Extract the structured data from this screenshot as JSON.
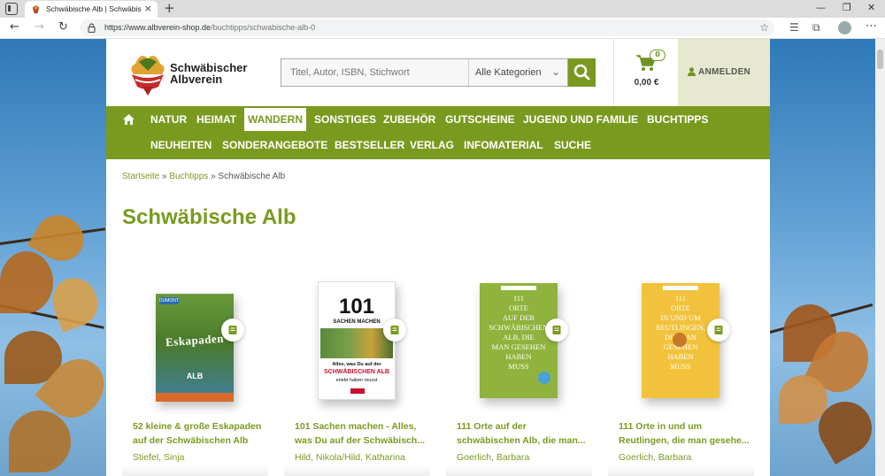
{
  "browser": {
    "tab_title": "Schwäbische Alb | Schwäbischer A",
    "url_host": "https://www.albverein-shop.de",
    "url_path": "/buchtipps/schwabische-alb-0"
  },
  "header": {
    "logo_line1": "Schwäbischer",
    "logo_line2": "Albverein",
    "search_placeholder": "Titel, Autor, ISBN, Stichwort",
    "category_selected": "Alle Kategorien",
    "cart_count": "0",
    "cart_total": "0,00 €",
    "login_label": "ANMELDEN"
  },
  "nav": {
    "row1": [
      "NATUR",
      "HEIMAT",
      "WANDERN",
      "SONSTIGES",
      "ZUBEHÖR",
      "GUTSCHEINE",
      "JUGEND UND FAMILIE",
      "BUCHTIPPS"
    ],
    "row2": [
      "NEUHEITEN",
      "SONDERANGEBOTE",
      "BESTSELLER",
      "VERLAG",
      "INFOMATERIAL",
      "SUCHE"
    ],
    "active": "WANDERN"
  },
  "breadcrumb": {
    "home": "Startseite",
    "sep": "»",
    "parent": "Buchtipps",
    "current": "Schwäbische Alb"
  },
  "page": {
    "title": "Schwäbische Alb"
  },
  "products": [
    {
      "title_line1": "52 kleine & große Eskapaden",
      "title_line2": "auf der Schwäbischen Alb",
      "author": "Stiefel, Sinja",
      "cover_brand": "DUMONT",
      "cover_main": "Eskapaden",
      "cover_sub": "ALB"
    },
    {
      "title_line1": "101 Sachen machen - Alles,",
      "title_line2": "was Du auf der Schwäbisch...",
      "author": "Hild, Nikola/Hild, Katharina",
      "cover_num": "101",
      "cover_sub": "SACHEN MACHEN",
      "cover_line1": "Alles, was Du auf der",
      "cover_line2": "SCHWÄBISCHEN ALB",
      "cover_line3": "erlebt haben musst"
    },
    {
      "title_line1": "111 Orte auf der",
      "title_line2": "schwäbischen Alb, die man...",
      "author": "Goerlich, Barbara",
      "cover_lines": [
        "111",
        "ORTE",
        "AUF DER",
        "SCHWÄBISCHEN",
        "ALB, DIE",
        "MAN GESEHEN",
        "HABEN",
        "MUSS"
      ]
    },
    {
      "title_line1": "111 Orte in und um",
      "title_line2": "Reutlingen, die man gesehe...",
      "author": "Goerlich, Barbara",
      "cover_lines": [
        "111",
        "ORTE",
        "IN UND UM",
        "REUTLINGEN,",
        "DIE MAN",
        "GESEHEN",
        "HABEN",
        "MUSS"
      ]
    }
  ],
  "colors": {
    "brand_green": "#7a9a1f",
    "login_bg": "#e6e8d0",
    "cover3": "#8fb33c",
    "cover4": "#f2c23c"
  }
}
